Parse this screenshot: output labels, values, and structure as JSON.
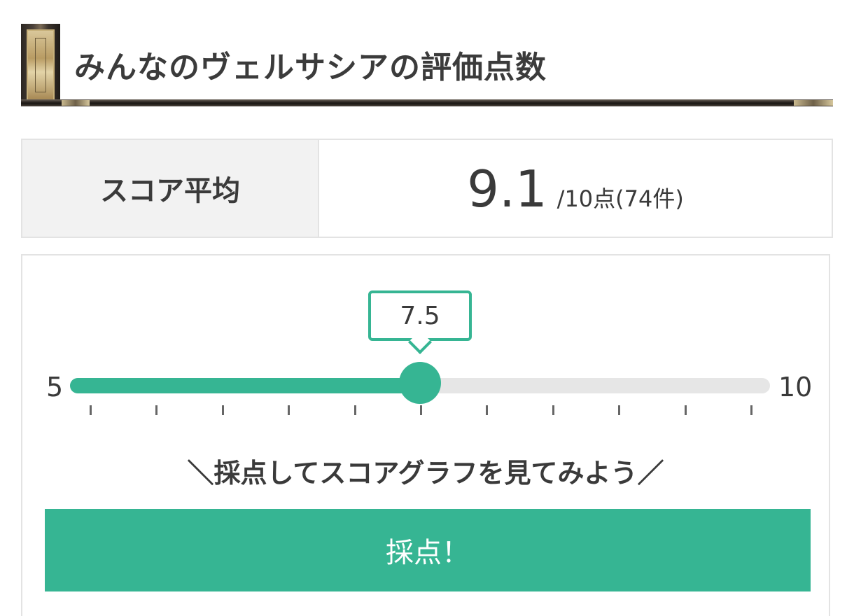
{
  "heading": {
    "title": "みんなのヴェルサシアの評価点数"
  },
  "score_summary": {
    "label": "スコア平均",
    "average": "9.1",
    "suffix": "/10点(74件)"
  },
  "rating": {
    "min_label": "5",
    "max_label": "10",
    "current_value": "7.5",
    "min": 5,
    "max": 10,
    "value": 7.5,
    "tick_count": 11,
    "prompt": "＼採点してスコアグラフを見てみよう／",
    "submit_label": "採点！"
  },
  "colors": {
    "accent": "#36b593",
    "track": "#e6e6e6",
    "label_cell_bg": "#f2f2f2",
    "border": "#e3e3e3",
    "text": "#3a3a3a"
  }
}
